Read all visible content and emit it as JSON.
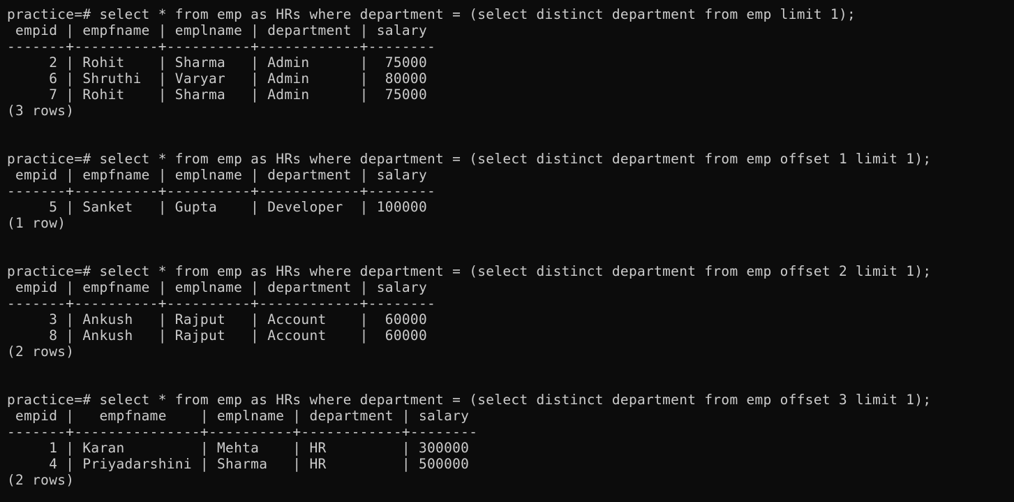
{
  "terminal": {
    "lines": [
      "practice=# select * from emp as HRs where department = (select distinct department from emp limit 1);",
      " empid | empfname | emplname | department | salary",
      "-------+----------+----------+------------+--------",
      "     2 | Rohit    | Sharma   | Admin      |  75000",
      "     6 | Shruthi  | Varyar   | Admin      |  80000",
      "     7 | Rohit    | Sharma   | Admin      |  75000",
      "(3 rows)",
      "",
      "",
      "practice=# select * from emp as HRs where department = (select distinct department from emp offset 1 limit 1);",
      " empid | empfname | emplname | department | salary",
      "-------+----------+----------+------------+--------",
      "     5 | Sanket   | Gupta    | Developer  | 100000",
      "(1 row)",
      "",
      "",
      "practice=# select * from emp as HRs where department = (select distinct department from emp offset 2 limit 1);",
      " empid | empfname | emplname | department | salary",
      "-------+----------+----------+------------+--------",
      "     3 | Ankush   | Rajput   | Account    |  60000",
      "     8 | Ankush   | Rajput   | Account    |  60000",
      "(2 rows)",
      "",
      "",
      "practice=# select * from emp as HRs where department = (select distinct department from emp offset 3 limit 1);",
      " empid |   empfname    | emplname | department | salary",
      "-------+---------------+----------+------------+--------",
      "     1 | Karan         | Mehta    | HR         | 300000",
      "     4 | Priyadarshini | Sharma   | HR         | 500000",
      "(2 rows)"
    ]
  }
}
